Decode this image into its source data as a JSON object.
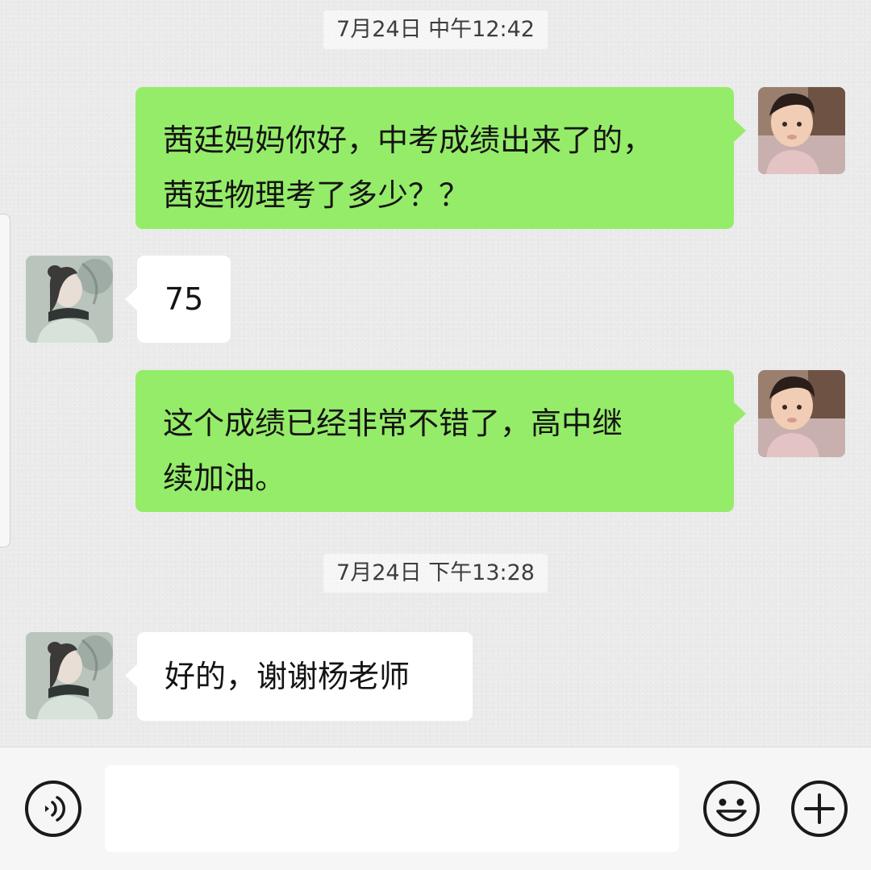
{
  "chat": {
    "messages": [
      {
        "kind": "timestamp",
        "text": "7月24日 中午12:42"
      },
      {
        "kind": "message",
        "side": "right",
        "sender": "me",
        "lines": [
          "茜廷妈妈你好，中考成绩出来了的，",
          "茜廷物理考了多少？？"
        ]
      },
      {
        "kind": "message",
        "side": "left",
        "sender": "contact",
        "lines": [
          "75"
        ]
      },
      {
        "kind": "message",
        "side": "right",
        "sender": "me",
        "lines": [
          "这个成绩已经非常不错了，高中继",
          "续加油。"
        ]
      },
      {
        "kind": "timestamp",
        "text": "7月24日 下午13:28"
      },
      {
        "kind": "message",
        "side": "left",
        "sender": "contact",
        "lines": [
          "好的，谢谢杨老师"
        ]
      }
    ]
  },
  "input_bar": {
    "text_value": "",
    "icons": {
      "voice": "voice-icon",
      "emoji": "emoji-icon",
      "more": "plus-icon"
    }
  },
  "colors": {
    "outgoing_bubble": "#95ec69",
    "incoming_bubble": "#ffffff",
    "chat_background": "#ebebeb"
  }
}
